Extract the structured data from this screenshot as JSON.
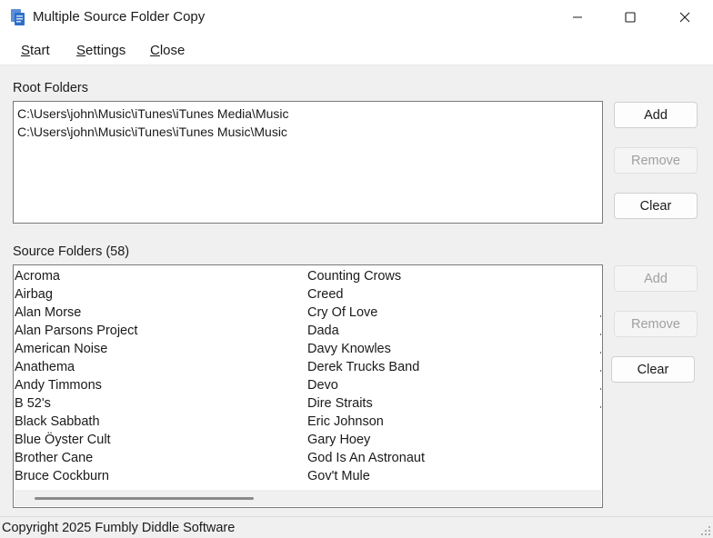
{
  "window": {
    "title": "Multiple Source Folder Copy",
    "app_icon": "folder-copy-icon",
    "controls": [
      "minimize-icon",
      "maximize-icon",
      "close-icon"
    ]
  },
  "menu": {
    "items": [
      "Start",
      "Settings",
      "Close"
    ]
  },
  "root_folders": {
    "label": "Root Folders",
    "items": [
      "C:\\Users\\john\\Music\\iTunes\\iTunes Media\\Music",
      "C:\\Users\\john\\Music\\iTunes\\iTunes Music\\Music"
    ],
    "buttons": {
      "add": "Add",
      "remove": "Remove",
      "clear": "Clear"
    },
    "remove_enabled": false
  },
  "source_folders": {
    "label": "Source Folders (58)",
    "column1": [
      "Acroma",
      "Airbag",
      "Alan Morse",
      "Alan Parsons Project",
      "American Noise",
      "Anathema",
      "Andy Timmons",
      "B 52's",
      "Black Sabbath",
      "Blue Öyster Cult",
      "Brother Cane",
      "Bruce Cockburn"
    ],
    "column2": [
      "Counting Crows",
      "Creed",
      "Cry Of Love",
      "Dada",
      "Davy Knowles",
      "Derek Trucks Band",
      "Devo",
      "Dire Straits",
      "Eric Johnson",
      "Gary Hoey",
      "God Is An Astronaut",
      "Gov't Mule"
    ],
    "buttons": {
      "add": "Add",
      "remove": "Remove",
      "clear": "Clear"
    },
    "add_enabled": false,
    "remove_enabled": false
  },
  "status": {
    "text": "Copyright 2025 Fumbly Diddle Software"
  },
  "colors": {
    "window_bg": "#f0f0f0",
    "list_bg": "#ffffff",
    "disabled_text": "#a0a0a0"
  }
}
